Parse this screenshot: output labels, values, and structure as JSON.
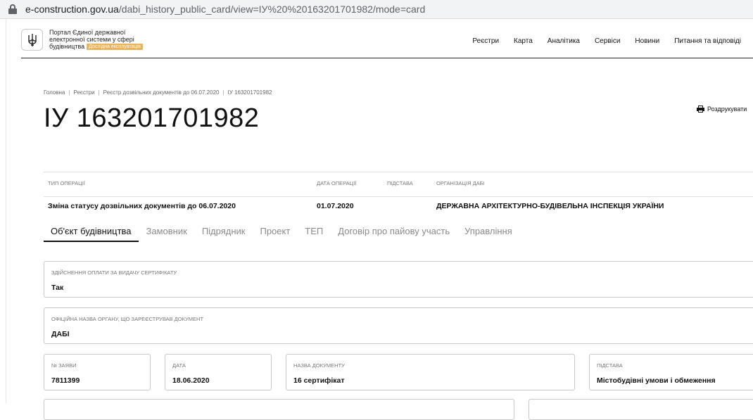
{
  "browser": {
    "url_host": "e-construction.gov.ua",
    "url_path": "/dabi_history_public_card/view=ІУ%20%20163201701982/mode=card"
  },
  "header": {
    "title_line1": "Портал Єдиної державної",
    "title_line2": "електронної системи у сфері",
    "title_line3": "будівництва",
    "badge": "Дослідна експлуатація",
    "nav": [
      "Реєстри",
      "Карта",
      "Аналітика",
      "Сервіси",
      "Новини",
      "Питання та відповіді"
    ]
  },
  "breadcrumb": [
    "Головна",
    "Реєстри",
    "Реєстр дозвільних документів до 06.07.2020",
    "ІУ 163201701982"
  ],
  "page_title": "ІУ 163201701982",
  "print_label": "Роздрукувати",
  "operation": {
    "headers": {
      "type": "Тип операції",
      "date": "Дата операції",
      "basis": "Підстава",
      "org": "Організація ДАБІ"
    },
    "values": {
      "type": "Зміна статусу дозвільних документів до 06.07.2020",
      "date": "01.07.2020",
      "basis": "",
      "org": "ДЕРЖАВНА АРХІТЕКТУРНО-БУДІВЕЛЬНА ІНСПЕКЦІЯ УКРАЇНИ"
    }
  },
  "tabs": [
    "Об'єкт будівництва",
    "Замовник",
    "Підрядник",
    "Проект",
    "ТЕП",
    "Договір про пайову участь",
    "Управління"
  ],
  "active_tab_index": 0,
  "fields": {
    "payment": {
      "label": "Здійснення оплати за видачу сертифікату",
      "value": "Так"
    },
    "org_name": {
      "label": "Офіційна назва органу, що зареєстрував документ",
      "value": "ДАБІ"
    },
    "app_no": {
      "label": "№ заяви",
      "value": "7811399"
    },
    "date": {
      "label": "Дата",
      "value": "18.06.2020"
    },
    "doc_name": {
      "label": "Назва документу",
      "value": "16 сертифікат"
    },
    "basis": {
      "label": "Підстава",
      "value": "Містобудівні умови і обмеження"
    }
  }
}
